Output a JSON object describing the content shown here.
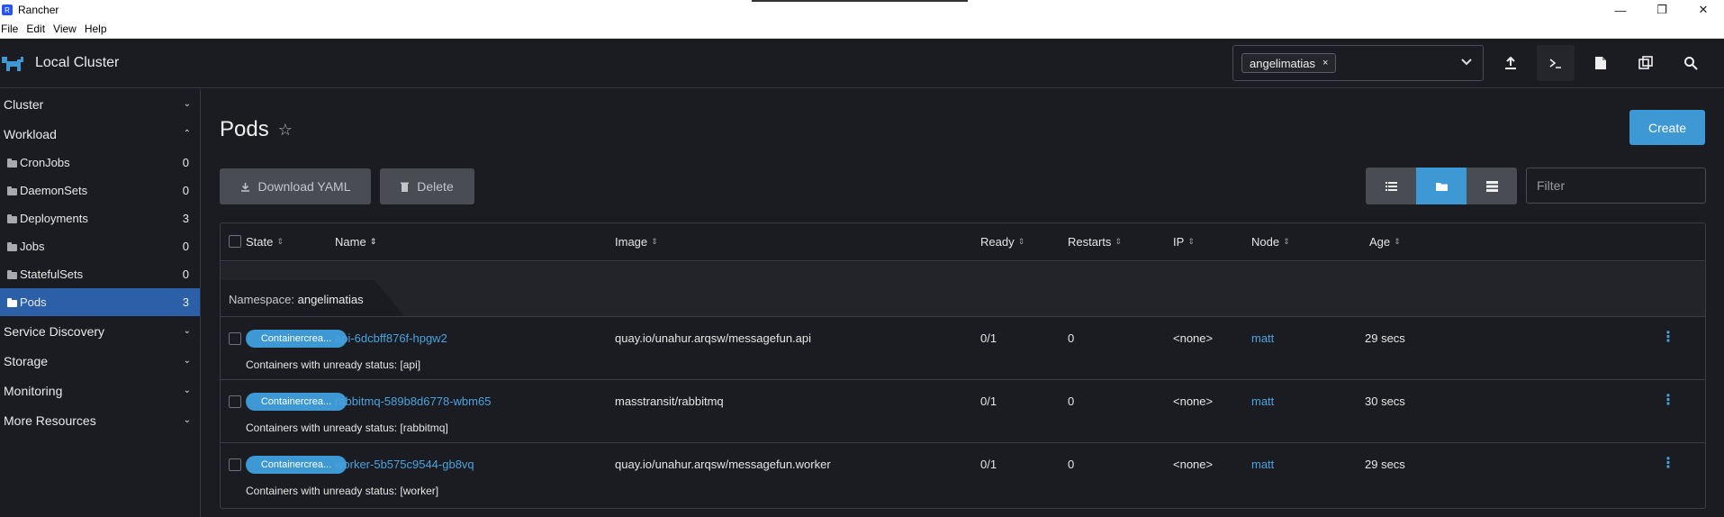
{
  "window": {
    "title": "Rancher",
    "controls": {
      "minimize": "—",
      "maximize": "❐",
      "close": "✕"
    }
  },
  "menubar": [
    "File",
    "Edit",
    "View",
    "Help"
  ],
  "header": {
    "cluster_name": "Local Cluster",
    "namespace_tag": "angelimatias",
    "namespace_remove": "×"
  },
  "sidebar": {
    "groups": {
      "cluster": "Cluster",
      "workload": "Workload",
      "service_discovery": "Service Discovery",
      "storage": "Storage",
      "monitoring": "Monitoring",
      "more_resources": "More Resources"
    },
    "workload_items": [
      {
        "label": "CronJobs",
        "count": "0"
      },
      {
        "label": "DaemonSets",
        "count": "0"
      },
      {
        "label": "Deployments",
        "count": "3"
      },
      {
        "label": "Jobs",
        "count": "0"
      },
      {
        "label": "StatefulSets",
        "count": "0"
      },
      {
        "label": "Pods",
        "count": "3"
      }
    ]
  },
  "main": {
    "title": "Pods",
    "star": "☆",
    "create_label": "Create",
    "download_label": "Download YAML",
    "delete_label": "Delete",
    "filter_placeholder": "Filter"
  },
  "table": {
    "columns": {
      "state": "State",
      "name": "Name",
      "image": "Image",
      "ready": "Ready",
      "restarts": "Restarts",
      "ip": "IP",
      "node": "Node",
      "age": "Age"
    },
    "group_prefix": "Namespace:",
    "group_name": "angelimatias",
    "rows": [
      {
        "state": "Containercrea...",
        "name": "api-6dcbff876f-hpgw2",
        "image": "quay.io/unahur.arqsw/messagefun.api",
        "ready": "0/1",
        "restarts": "0",
        "ip": "<none>",
        "node": "matt",
        "age": "29 secs",
        "detail": "Containers with unready status: [api]"
      },
      {
        "state": "Containercrea...",
        "name": "rabbitmq-589b8d6778-wbm65",
        "image": "masstransit/rabbitmq",
        "ready": "0/1",
        "restarts": "0",
        "ip": "<none>",
        "node": "matt",
        "age": "30 secs",
        "detail": "Containers with unready status: [rabbitmq]"
      },
      {
        "state": "Containercrea...",
        "name": "worker-5b575c9544-gb8vq",
        "image": "quay.io/unahur.arqsw/messagefun.worker",
        "ready": "0/1",
        "restarts": "0",
        "ip": "<none>",
        "node": "matt",
        "age": "29 secs",
        "detail": "Containers with unready status: [worker]"
      }
    ]
  },
  "colors": {
    "accent": "#3d98d3",
    "link": "#4aa3df",
    "active_nav": "#2b5fa8",
    "background": "#1b1c21"
  }
}
